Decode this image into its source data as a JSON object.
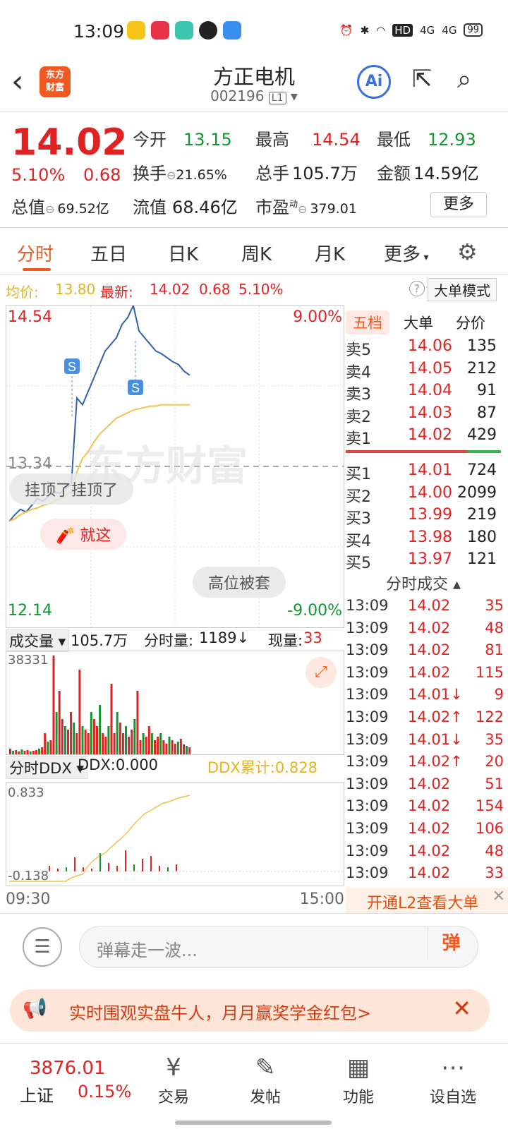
{
  "status": {
    "time": "13:09",
    "battery": "99",
    "signal1": "4G",
    "signal2": "4G",
    "hd": "HD"
  },
  "header": {
    "back": "‹",
    "logo_line1": "东方",
    "logo_line2": "财富",
    "title": "方正电机",
    "code": "002196",
    "level": "L1",
    "ai": "Ai",
    "share_icon": "share-icon",
    "search_icon": "search-icon"
  },
  "quote": {
    "price": "14.02",
    "pct": "5.10%",
    "change": "0.68",
    "open_label": "今开",
    "open": "13.15",
    "high_label": "最高",
    "high": "14.54",
    "low_label": "最低",
    "low": "12.93",
    "turnover_label": "换手",
    "turnover": "21.65%",
    "volume_label": "总手",
    "volume": "105.7万",
    "amount_label": "金额",
    "amount": "14.59亿",
    "mktcap_label": "总值",
    "mktcap": "69.52亿",
    "float_label": "流值",
    "float": "68.46亿",
    "pe_label": "市盈",
    "pe_sup": "动",
    "pe": "379.01",
    "more": "更多"
  },
  "tabs": [
    "分时",
    "五日",
    "日K",
    "周K",
    "月K",
    "更多"
  ],
  "infobar": {
    "avg_label": "均价:",
    "avg": "13.80",
    "latest_label": "最新:",
    "latest": "14.02",
    "change": "0.68",
    "pct": "5.10%",
    "help": "?",
    "bigmode": "大单模式"
  },
  "chart": {
    "y_top": "14.54",
    "y_mid": "13.34",
    "y_bot": "12.14",
    "pct_top": "9.00%",
    "pct_bot": "-9.00%",
    "watermark": "东方财富",
    "bubble1": "挂顶了挂顶了",
    "bubble2": "就这",
    "bubble3": "高位被套",
    "s_marker": "S",
    "colors": {
      "price_line": "#2f62a8",
      "avg_line": "#f2c14e",
      "up": "#e02222",
      "down": "#12962d"
    }
  },
  "chart_data": {
    "type": "line",
    "prev_close": 13.34,
    "ylim": [
      12.14,
      14.54
    ],
    "x_range": [
      "09:30",
      "15:00"
    ],
    "series": [
      {
        "values": [
          12.93,
          12.98,
          13.02,
          13.0,
          13.05,
          13.1,
          13.08,
          13.12,
          13.15,
          13.14,
          13.18,
          13.2,
          13.85,
          13.8,
          13.9,
          14.0,
          14.1,
          14.2,
          14.25,
          14.3,
          14.4,
          14.45,
          14.54,
          14.35,
          14.3,
          14.25,
          14.2,
          14.18,
          14.15,
          14.12,
          14.1,
          14.05,
          14.02
        ]
      },
      {
        "values": [
          12.93,
          12.95,
          12.98,
          13.0,
          13.02,
          13.03,
          13.05,
          13.06,
          13.08,
          13.1,
          13.12,
          13.15,
          13.3,
          13.4,
          13.45,
          13.52,
          13.58,
          13.62,
          13.66,
          13.7,
          13.72,
          13.74,
          13.76,
          13.77,
          13.78,
          13.79,
          13.79,
          13.8,
          13.8,
          13.8,
          13.8,
          13.8,
          13.8
        ]
      }
    ]
  },
  "volume": {
    "label": "成交量",
    "total": "105.7万",
    "tick_label": "分时量:",
    "tick": "1189",
    "tick_arrow": "↓",
    "now_label": "现量:",
    "now": "33",
    "max": "38331"
  },
  "ddx": {
    "label": "分时DDX",
    "value_label": "DDX:",
    "value": "0.000",
    "cum_label": "DDX累计:",
    "cum": "0.828",
    "top": "0.833",
    "bot": "-0.138"
  },
  "timeaxis": {
    "start": "09:30",
    "end": "15:00"
  },
  "orderbook": {
    "tabs": [
      "五档",
      "大单",
      "分价"
    ],
    "asks": [
      {
        "label": "卖5",
        "price": "14.06",
        "vol": "135"
      },
      {
        "label": "卖4",
        "price": "14.05",
        "vol": "212"
      },
      {
        "label": "卖3",
        "price": "14.04",
        "vol": "91"
      },
      {
        "label": "卖2",
        "price": "14.03",
        "vol": "87"
      },
      {
        "label": "卖1",
        "price": "14.02",
        "vol": "429"
      }
    ],
    "bids": [
      {
        "label": "买1",
        "price": "14.01",
        "vol": "724"
      },
      {
        "label": "买2",
        "price": "14.00",
        "vol": "2099"
      },
      {
        "label": "买3",
        "price": "13.99",
        "vol": "219"
      },
      {
        "label": "买4",
        "price": "13.98",
        "vol": "180"
      },
      {
        "label": "买5",
        "price": "13.97",
        "vol": "121"
      }
    ],
    "trades_title": "分时成交",
    "trades": [
      {
        "t": "13:09",
        "p": "14.02",
        "v": "35"
      },
      {
        "t": "13:09",
        "p": "14.02",
        "v": "48"
      },
      {
        "t": "13:09",
        "p": "14.02",
        "v": "81"
      },
      {
        "t": "13:09",
        "p": "14.02",
        "v": "115"
      },
      {
        "t": "13:09",
        "p": "14.01↓",
        "v": "9"
      },
      {
        "t": "13:09",
        "p": "14.02↑",
        "v": "122"
      },
      {
        "t": "13:09",
        "p": "14.01↓",
        "v": "35"
      },
      {
        "t": "13:09",
        "p": "14.02↑",
        "v": "20"
      },
      {
        "t": "13:09",
        "p": "14.02",
        "v": "51"
      },
      {
        "t": "13:09",
        "p": "14.02",
        "v": "154"
      },
      {
        "t": "13:09",
        "p": "14.02",
        "v": "106"
      },
      {
        "t": "13:09",
        "p": "14.02",
        "v": "48"
      },
      {
        "t": "13:09",
        "p": "14.02",
        "v": "33"
      }
    ],
    "l2": "开通L2查看大单"
  },
  "comment": {
    "placeholder": "弹幕走一波...",
    "danmu": "弹"
  },
  "promo": {
    "text": "实时围观实盘牛人，月月赢奖学金红包>"
  },
  "nav": {
    "index_value": "3876.01",
    "index_name": "上证",
    "index_pct": "0.15%",
    "items": [
      "交易",
      "发帖",
      "功能",
      "设自选"
    ]
  }
}
